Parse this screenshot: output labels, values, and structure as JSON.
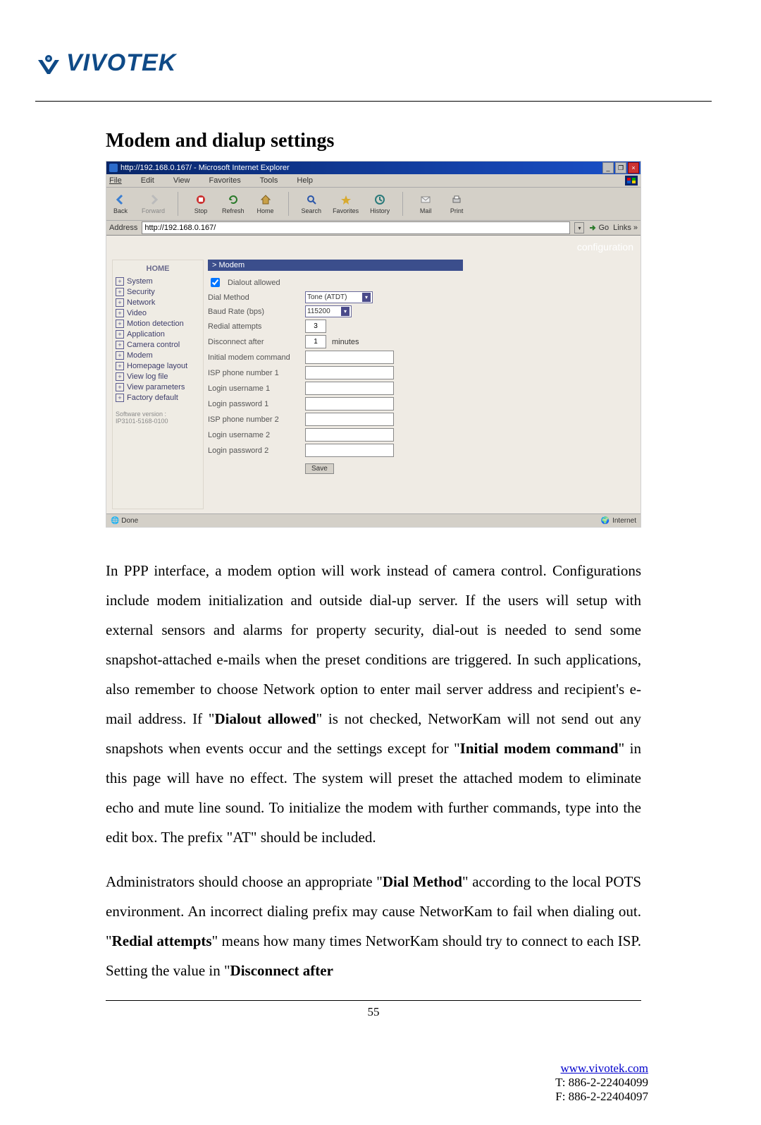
{
  "header": {
    "logo_text": "VIVOTEK"
  },
  "heading": "Modem and dialup settings",
  "browser": {
    "title": "http://192.168.0.167/ - Microsoft Internet Explorer",
    "winbtns": {
      "min": "_",
      "max": "❐",
      "close": "×"
    },
    "menu": [
      "File",
      "Edit",
      "View",
      "Favorites",
      "Tools",
      "Help"
    ],
    "toolbar": {
      "back": "Back",
      "forward": "Forward",
      "stop": "Stop",
      "refresh": "Refresh",
      "home": "Home",
      "search": "Search",
      "favorites": "Favorites",
      "history": "History",
      "mail": "Mail",
      "print": "Print"
    },
    "address_label": "Address",
    "address_value": "http://192.168.0.167/",
    "go_label": "Go",
    "links_label": "Links »",
    "status_left": "Done",
    "status_right": "Internet",
    "page": {
      "banner": "configuration",
      "home": "HOME",
      "nav": [
        "System",
        "Security",
        "Network",
        "Video",
        "Motion detection",
        "Application",
        "Camera control",
        "Modem",
        "Homepage layout",
        "View log file",
        "View parameters",
        "Factory default"
      ],
      "sw_label": "Software version :",
      "sw_value": "IP3101-5168-0100",
      "panel_title": "> Modem",
      "rows": {
        "dialout_allowed": "Dialout allowed",
        "dial_method": "Dial Method",
        "dial_method_value": "Tone (ATDT)",
        "baud_rate": "Baud Rate (bps)",
        "baud_rate_value": "115200",
        "redial": "Redial attempts",
        "redial_value": "3",
        "disconnect": "Disconnect after",
        "disconnect_value": "1",
        "minutes": "minutes",
        "init_cmd": "Initial modem command",
        "isp_phone1": "ISP phone number 1",
        "login_user1": "Login username 1",
        "login_pass1": "Login password 1",
        "isp_phone2": "ISP phone number 2",
        "login_user2": "Login username 2",
        "login_pass2": "Login password 2",
        "save": "Save"
      }
    }
  },
  "body_text": {
    "p1_a": "In PPP interface, a modem option will work instead of camera control. Configurations include modem initialization and outside dial-up server. If the users will setup with external sensors and alarms for property security, dial-out is needed to send some snapshot-attached e-mails when the preset conditions are triggered. In such applications, also remember to choose Network option to enter mail server address and recipient's e-mail address. If \"",
    "p1_b1": "Dialout allowed",
    "p1_c": "\" is not checked, NetworKam will not send out any snapshots when events occur and the settings except for \"",
    "p1_b2": "Initial modem command",
    "p1_d": "\" in this page will have no effect. The system will preset the attached modem to eliminate echo and mute line sound. To initialize the modem with further commands, type into the edit box. The prefix \"AT\" should be included.",
    "p2_a": "Administrators should choose an appropriate \"",
    "p2_b1": "Dial Method",
    "p2_b": "\" according to the local POTS environment. An incorrect dialing prefix may cause NetworKam to fail when dialing out. \"",
    "p2_b2": "Redial attempts",
    "p2_c": "\" means how many times NetworKam should try to connect to each ISP. Setting the value in \"",
    "p2_b3": "Disconnect after"
  },
  "page_number": "55",
  "footer": {
    "url": "www.vivotek.com",
    "tel": "T: 886-2-22404099",
    "fax": "F: 886-2-22404097"
  }
}
